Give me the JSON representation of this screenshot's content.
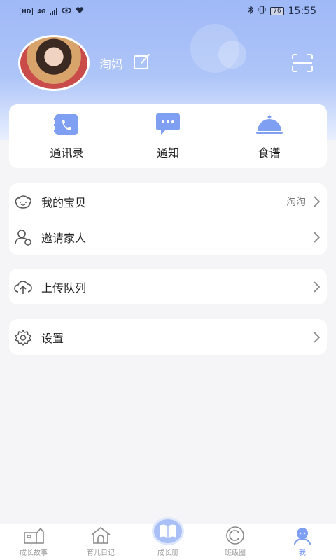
{
  "status_bar": {
    "left_badges": [
      "HD",
      "4G"
    ],
    "battery": "76",
    "time": "15:55"
  },
  "profile": {
    "username": "淘妈"
  },
  "quick_actions": [
    {
      "label": "通讯录",
      "icon": "contacts-book-icon"
    },
    {
      "label": "通知",
      "icon": "message-bubble-icon"
    },
    {
      "label": "食谱",
      "icon": "food-cloche-icon"
    }
  ],
  "menu_family": [
    {
      "label": "我的宝贝",
      "value": "淘淘",
      "icon": "baby-face-icon"
    },
    {
      "label": "邀请家人",
      "value": "",
      "icon": "invite-person-icon"
    }
  ],
  "menu_upload": {
    "label": "上传队列",
    "icon": "cloud-upload-icon"
  },
  "menu_settings": {
    "label": "设置",
    "icon": "gear-icon"
  },
  "tabbar": [
    {
      "label": "成长故事",
      "icon": "story-house-icon"
    },
    {
      "label": "育儿日记",
      "icon": "diary-house-icon"
    },
    {
      "label": "成长册",
      "icon": "open-book-icon"
    },
    {
      "label": "班级圈",
      "icon": "circle-icon"
    },
    {
      "label": "我",
      "icon": "person-icon"
    }
  ],
  "colors": {
    "accent": "#6f8ff2",
    "icon_blue": "#7f9ff3",
    "header_top": "#9fb9f7"
  }
}
